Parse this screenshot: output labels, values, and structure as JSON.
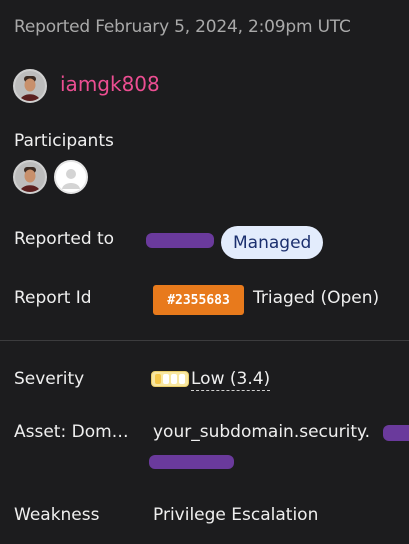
{
  "header": {
    "reported_date": "Reported February 5, 2024, 2:09pm UTC"
  },
  "reporter": {
    "username": "iamgk808"
  },
  "participants": {
    "label": "Participants"
  },
  "reported_to": {
    "label": "Reported to",
    "badge": "Managed"
  },
  "report_id": {
    "label": "Report Id",
    "id": "#2355683",
    "status": "Triaged (Open)"
  },
  "severity": {
    "label": "Severity",
    "value": "Low (3.4)",
    "level_fraction": 0.25
  },
  "asset": {
    "label": "Asset: Dom…",
    "value": "your_subdomain.security."
  },
  "weakness": {
    "label": "Weakness",
    "value": "Privilege Escalation"
  },
  "colors": {
    "accent_username": "#ec4e92",
    "report_id_badge": "#e87a1c",
    "managed_pill_bg": "#e3ecfc",
    "redaction": "#6a3a9c"
  }
}
